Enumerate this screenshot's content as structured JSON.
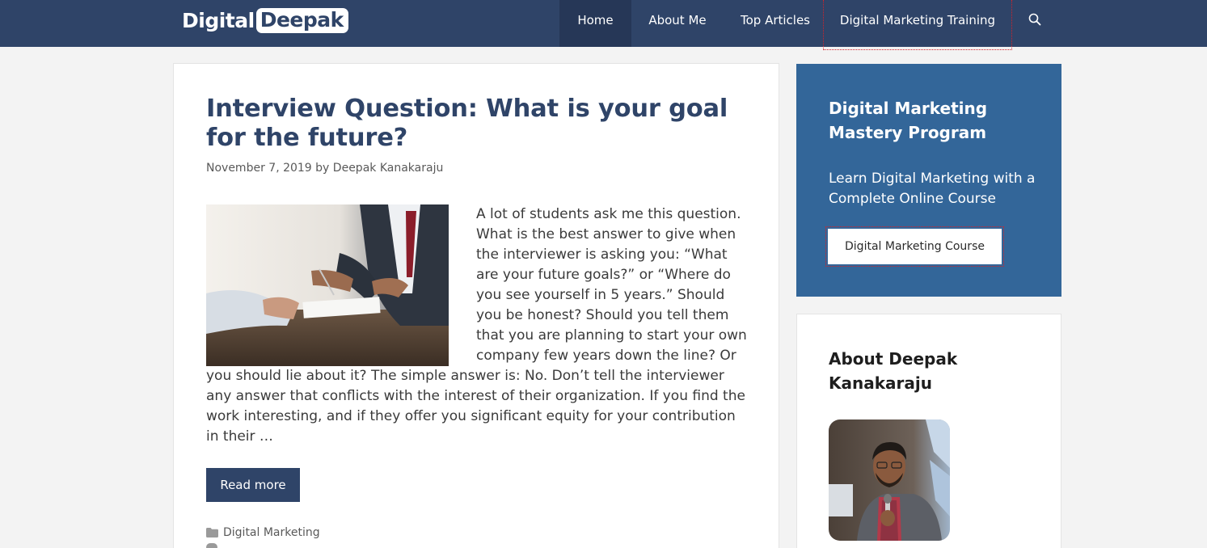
{
  "header": {
    "logo_part1": "Digital",
    "logo_part2": "Deepak",
    "nav": [
      {
        "label": "Home"
      },
      {
        "label": "About Me"
      },
      {
        "label": "Top Articles"
      },
      {
        "label": "Digital Marketing Training"
      }
    ],
    "search_icon": "search-icon"
  },
  "article": {
    "title": "Interview Question: What is your goal for the future?",
    "date": "November 7, 2019",
    "by": "by",
    "author": "Deepak Kanakaraju",
    "excerpt": "A lot of students ask me this question. What is the best answer to give when the interviewer is asking you: “What are your future goals?” or “Where do you see yourself in 5 years.” Should you be honest? Should you tell them that you are planning to start your own company few years down the line? Or you should lie about it? The simple answer is: No. Don’t tell the interviewer any answer that conflicts with the interest of their organization. If you find the work interesting, and if they offer you significant equity for your contribution in their …",
    "read_more": "Read more",
    "category": "Digital Marketing"
  },
  "sidebar": {
    "promo_title": "Digital Marketing Mastery Program",
    "promo_text": "Learn Digital Marketing with a Complete Online Course",
    "promo_button": "Digital Marketing Course",
    "about_title": "About Deepak Kanakaraju"
  },
  "colors": {
    "header_bg": "#2f4468",
    "promo_bg": "#336699",
    "accent_dotted": "#d2232a"
  }
}
